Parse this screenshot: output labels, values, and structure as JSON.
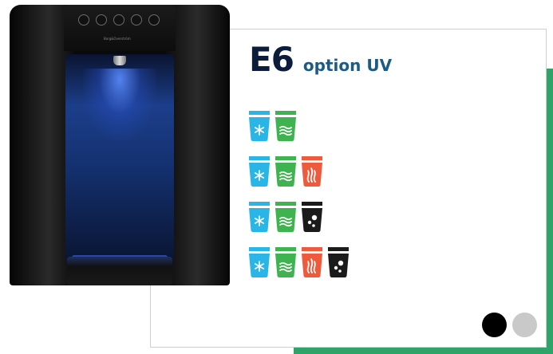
{
  "product": {
    "model": "E6",
    "option": "option UV",
    "brand_label": "Borg&Overström"
  },
  "colors": {
    "accent_green": "#2ea36a",
    "title_navy": "#0b1d3a",
    "option_blue": "#1d5a84",
    "cold_blue": "#29b6e6",
    "ambient_green": "#3fb34f",
    "hot_red": "#ef5a3c",
    "sparkling_black": "#1b1b1b"
  },
  "configurations": [
    {
      "cups": [
        "cold",
        "ambient"
      ]
    },
    {
      "cups": [
        "cold",
        "ambient",
        "hot"
      ]
    },
    {
      "cups": [
        "cold",
        "ambient",
        "sparkling"
      ]
    },
    {
      "cups": [
        "cold",
        "ambient",
        "hot",
        "sparkling"
      ]
    }
  ],
  "cup_icons": {
    "cold": "snowflake-cup-icon",
    "ambient": "waves-cup-icon",
    "hot": "flame-cup-icon",
    "sparkling": "bubbles-cup-icon"
  },
  "color_swatches": [
    {
      "name": "black",
      "color": "#000000",
      "selected": true
    },
    {
      "name": "grey",
      "color": "#c9c9c9",
      "selected": false
    }
  ]
}
